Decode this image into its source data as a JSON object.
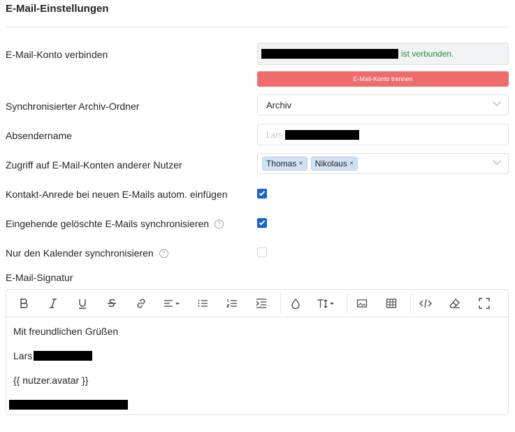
{
  "page": {
    "title": "E-Mail-Einstellungen"
  },
  "account": {
    "label": "E-Mail-Konto verbinden",
    "status": "ist verbunden.",
    "disconnect_label": "E-Mail-Konto trennen"
  },
  "archive": {
    "label": "Synchronisierter Archiv-Ordner",
    "value": "Archiv"
  },
  "sender": {
    "label": "Absendername",
    "value_visible": "Lars"
  },
  "access": {
    "label": "Zugriff auf E-Mail-Konten anderer Nutzer",
    "tags": [
      "Thomas",
      "Nikolaus"
    ],
    "remove_glyph": "×"
  },
  "options": [
    {
      "label": "Kontakt-Anrede bei neuen E-Mails autom. einfügen",
      "checked": true,
      "help": false
    },
    {
      "label": "Eingehende gelöschte E-Mails synchronisieren",
      "checked": true,
      "help": true
    },
    {
      "label": "Nur den Kalender synchronisieren",
      "checked": false,
      "help": true
    }
  ],
  "help_glyph": "?",
  "signature": {
    "label": "E-Mail-Signatur",
    "lines": [
      "Mit freundlichen Grüßen",
      "Lars",
      "{{ nutzer.avatar }}"
    ],
    "toolbar": [
      "bold-icon",
      "italic-icon",
      "underline-icon",
      "strikethrough-icon",
      "link-icon",
      "align-icon",
      "bullet-list-icon",
      "numbered-list-icon",
      "indent-icon",
      "color-drop-icon",
      "font-size-icon",
      "image-icon",
      "table-icon",
      "code-icon",
      "eraser-icon",
      "fullscreen-icon"
    ]
  },
  "colors": {
    "accent": "#1762d6",
    "danger": "#f06c6c",
    "success": "#1e8e3e",
    "tag_bg": "#cfe2f3"
  }
}
